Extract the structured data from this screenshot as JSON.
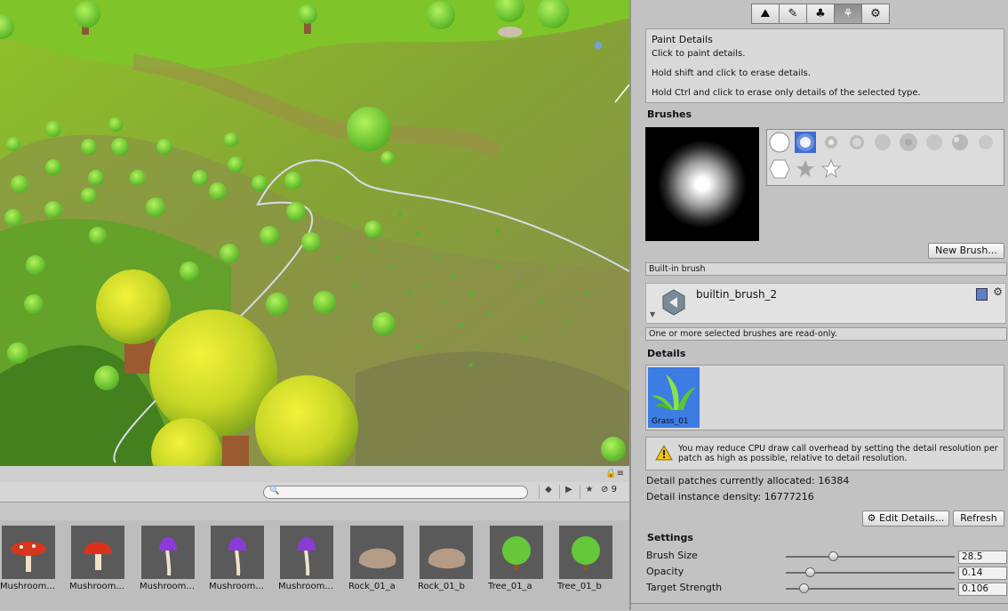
{
  "project": {
    "hidden_count": "9",
    "assets": [
      {
        "label": "Mushroom...",
        "kind": "red-mushroom"
      },
      {
        "label": "Mushroom...",
        "kind": "red-mushroom-round"
      },
      {
        "label": "Mushroom...",
        "kind": "purple-mushroom"
      },
      {
        "label": "Mushroom...",
        "kind": "purple-mushroom"
      },
      {
        "label": "Mushroom...",
        "kind": "purple-mushroom"
      },
      {
        "label": "Rock_01_a",
        "kind": "rock"
      },
      {
        "label": "Rock_01_b",
        "kind": "rock"
      },
      {
        "label": "Tree_01_a",
        "kind": "tree"
      },
      {
        "label": "Tree_01_b",
        "kind": "tree"
      }
    ]
  },
  "inspector": {
    "tools": [
      "raise-lower-icon",
      "paint-texture-icon",
      "place-trees-icon",
      "paint-details-icon",
      "settings-icon"
    ],
    "help": {
      "title": "Paint Details",
      "line1": "Click to paint details.",
      "line2": "Hold shift and click to erase details.",
      "line3": "Hold Ctrl and click to erase only details of the selected type."
    },
    "brushes_header": "Brushes",
    "new_brush_label": "New Brush...",
    "builtin_brush_label": "Built-in brush",
    "brush_name": "builtin_brush_2",
    "readonly_note": "One or more selected brushes are read-only.",
    "details_header": "Details",
    "detail_item": "Grass_01",
    "warning": "You may reduce CPU draw call overhead by setting the detail resolution per patch as high as possible, relative to detail resolution.",
    "patches": "Detail patches currently allocated: 16384",
    "density": "Detail instance density: 16777216",
    "edit_details_label": "⚙ Edit Details...",
    "refresh_label": "Refresh",
    "settings_header": "Settings",
    "settings": [
      {
        "label": "Brush Size",
        "value": "28.5",
        "fraction": 0.28
      },
      {
        "label": "Opacity",
        "value": "0.14",
        "fraction": 0.14
      },
      {
        "label": "Target Strength",
        "value": "0.106",
        "fraction": 0.106
      }
    ]
  },
  "colors": {
    "selection_blue": "#3c7ce3",
    "grass": "#5fa92a"
  }
}
